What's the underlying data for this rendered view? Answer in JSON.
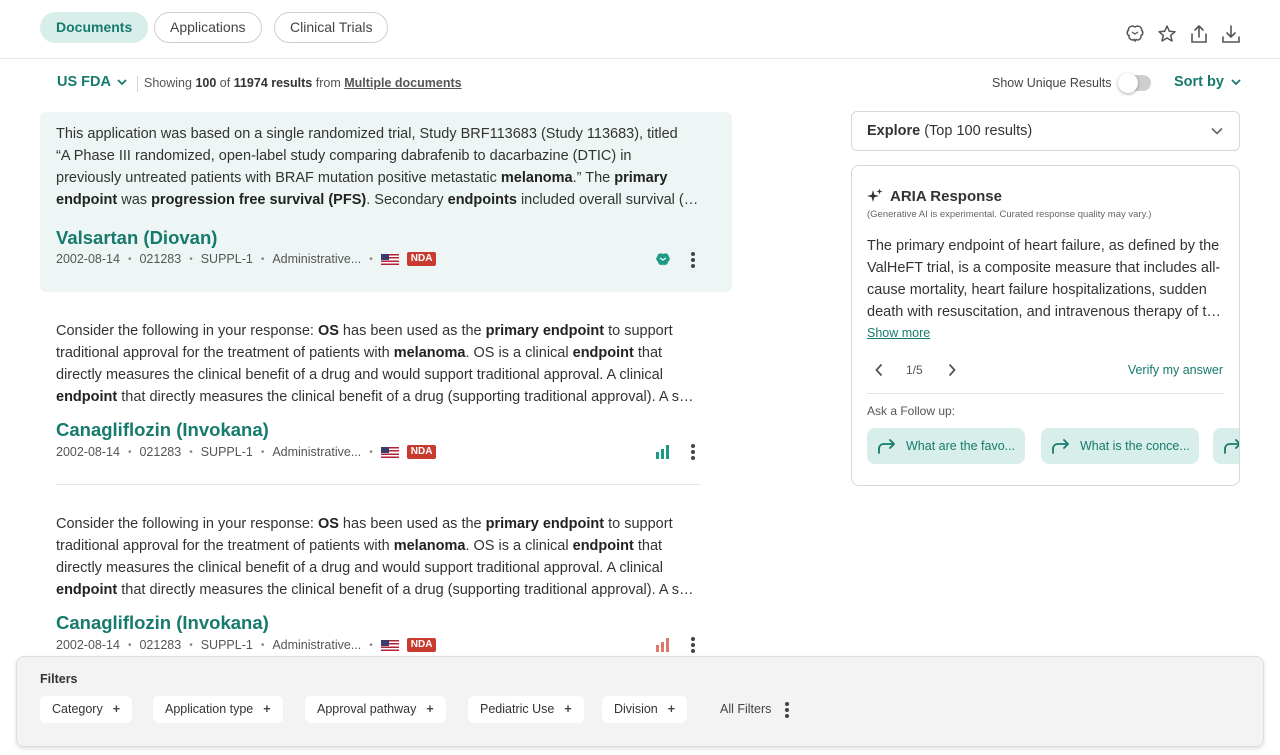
{
  "tabs": [
    {
      "label": "Documents",
      "active": true
    },
    {
      "label": "Applications",
      "active": false
    },
    {
      "label": "Clinical Trials",
      "active": false
    }
  ],
  "toolbar_icons": [
    "brain-icon",
    "star-icon",
    "share-icon",
    "download-icon"
  ],
  "subheader": {
    "region": "US FDA",
    "showing_prefix": "Showing",
    "shown_count": "100",
    "of_text": "of",
    "total_results": "11974 results",
    "from_text": "from",
    "source": "Multiple documents",
    "unique_label": "Show Unique Results",
    "unique_on": false,
    "sort_label": "Sort by"
  },
  "results": [
    {
      "snippet_lines": [
        [
          {
            "t": "This application was based on a single randomized trial, Study BRF113683 (Study 113683), titled"
          }
        ],
        [
          {
            "t": "“A Phase III randomized, open-label study comparing dabrafenib to dacarbazine (DTIC) in"
          }
        ],
        [
          {
            "t": "previously untreated patients with BRAF mutation positive metastatic "
          },
          {
            "t": "melanoma",
            "b": true
          },
          {
            "t": ".” The "
          },
          {
            "t": "primary",
            "b": true
          }
        ],
        [
          {
            "t": "endpoint",
            "b": true
          },
          {
            "t": " was "
          },
          {
            "t": "progression free survival (PFS)",
            "b": true
          },
          {
            "t": ". Secondary "
          },
          {
            "t": "endpoints",
            "b": true
          },
          {
            "t": " included overall survival (OS), and response rate."
          }
        ]
      ],
      "title": "Valsartan (Diovan)",
      "date": "2002-08-14",
      "number": "021283",
      "supplement": "SUPPL-1",
      "category": "Administrative...",
      "badge": "NDA",
      "indicator_icon": "brain-icon"
    },
    {
      "snippet_lines": [
        [
          {
            "t": "Consider the following in your response: "
          },
          {
            "t": "OS",
            "b": true
          },
          {
            "t": " has been used as the "
          },
          {
            "t": "primary endpoint",
            "b": true
          },
          {
            "t": " to support"
          }
        ],
        [
          {
            "t": "traditional approval for the treatment of patients with "
          },
          {
            "t": "melanoma",
            "b": true
          },
          {
            "t": ". OS is a clinical "
          },
          {
            "t": "endpoint",
            "b": true
          },
          {
            "t": " that"
          }
        ],
        [
          {
            "t": "directly measures the clinical benefit of a drug and would support traditional approval. A clinical"
          }
        ],
        [
          {
            "t": "endpoint",
            "b": true
          },
          {
            "t": " that directly measures the clinical benefit of a drug (supporting traditional approval). A surrogate endpoint"
          }
        ]
      ],
      "title": "Canagliflozin (Invokana)",
      "date": "2002-08-14",
      "number": "021283",
      "supplement": "SUPPL-1",
      "category": "Administrative...",
      "badge": "NDA",
      "indicator_icon": "bar-chart-icon"
    },
    {
      "snippet_lines": [
        [
          {
            "t": "Consider the following in your response: "
          },
          {
            "t": "OS",
            "b": true
          },
          {
            "t": " has been used as the "
          },
          {
            "t": "primary endpoint",
            "b": true
          },
          {
            "t": " to support"
          }
        ],
        [
          {
            "t": "traditional approval for the treatment of patients with "
          },
          {
            "t": "melanoma",
            "b": true
          },
          {
            "t": ". OS is a clinical "
          },
          {
            "t": "endpoint",
            "b": true
          },
          {
            "t": " that"
          }
        ],
        [
          {
            "t": "directly measures the clinical benefit of a drug and would support traditional approval. A clinical"
          }
        ],
        [
          {
            "t": "endpoint",
            "b": true
          },
          {
            "t": " that directly measures the clinical benefit of a drug (supporting traditional approval). A surrogate endpoint"
          }
        ]
      ],
      "title": "Canagliflozin (Invokana)",
      "date": "2002-08-14",
      "number": "021283",
      "supplement": "SUPPL-1",
      "category": "Administrative...",
      "badge": "NDA",
      "indicator_icon": "bar-chart-icon"
    }
  ],
  "explore": {
    "label": "Explore",
    "suffix": "(Top 100 results)"
  },
  "aria": {
    "title": "ARIA Response",
    "disclaimer": "(Generative AI is experimental. Curated response quality may vary.)",
    "response_lines": [
      "The primary endpoint of heart failure, as defined by the",
      "ValHeFT trial, is a composite measure that includes all-",
      "cause mortality, heart failure hospitalizations, sudden",
      "death with resuscitation, and intravenous therapy of the worsening heart failure."
    ],
    "show_more": "Show more",
    "pager": "1/5",
    "verify": "Verify my answer",
    "followup_label": "Ask a Follow up:",
    "followups": [
      "What are the favo...",
      "What is the conce..."
    ]
  },
  "filters": {
    "title": "Filters",
    "chips": [
      "Category",
      "Application type",
      "Approval pathway",
      "Pediatric Use",
      "Division"
    ],
    "all_filters": "All Filters"
  },
  "colors": {
    "accent": "#167a6c",
    "accent_bg": "#d8eeea",
    "badge": "#c93b2f",
    "bar_green": "#1c9a85",
    "bar_red": "#e0786a"
  }
}
